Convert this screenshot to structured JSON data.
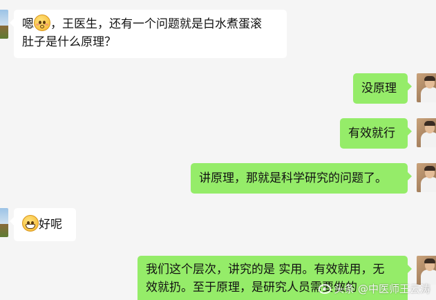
{
  "messages": [
    {
      "side": "left",
      "text_after_emoji": "，王医生，还有一个问题就是白水煮蛋滚",
      "line2": "肚子是什么原理？",
      "prefix": "嗯",
      "emoji": "pleading-face-emoji"
    },
    {
      "side": "right",
      "text": "没原理"
    },
    {
      "side": "right",
      "text": "有效就行"
    },
    {
      "side": "right",
      "text": "讲原理，那就是科学研究的问题了。"
    },
    {
      "side": "left",
      "text": "好呢",
      "emoji": "grinning-face-emoji"
    },
    {
      "side": "right",
      "line1": "我们这个层次，讲究的是 实用。有效就用，无",
      "line2": "效就扔。至于原理，是研究人员需要做的"
    }
  ],
  "watermark": {
    "text": "头条 @中医师王云涛",
    "icon": "weibo-icon"
  },
  "colors": {
    "background": "#f5f5f5",
    "left_bubble": "#ffffff",
    "right_bubble": "#95ec69"
  }
}
